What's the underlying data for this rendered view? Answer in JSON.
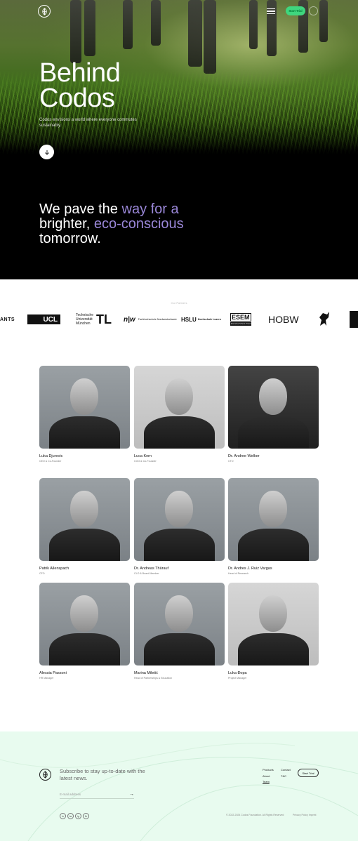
{
  "header": {
    "start_label": "Start Trial",
    "icons": [
      "codos-logo-icon",
      "menu-icon",
      "language-icon"
    ]
  },
  "hero": {
    "title_line1": "Behind",
    "title_line2": "Codos",
    "subtitle": "Codos envisions a world where everyone commutes sustainably."
  },
  "tagline": {
    "part1": "We pave the",
    "accent1": "way for a",
    "part2": "brighter,",
    "accent2": "eco-conscious",
    "part3": "tomorrow."
  },
  "partners": {
    "label": "Our Partners",
    "logos": [
      {
        "name": "ANTS"
      },
      {
        "name": "UCL"
      },
      {
        "line1": "Technische",
        "line2": "Universität",
        "line3": "München",
        "mark": "TL"
      },
      {
        "name": "n|w",
        "sub": "Fachhochschule Nordwestschweiz"
      },
      {
        "name": "HSLU",
        "sub": "Hochschule Luzern"
      },
      {
        "name": "ESEM",
        "sub": "Executive School of Economics and Management"
      },
      {
        "name": "HOBW"
      }
    ]
  },
  "team": [
    {
      "name": "Luka Djurovic",
      "role": "CEO & Co-Founder"
    },
    {
      "name": "Luca Kern",
      "role": "COO & Co-Founder"
    },
    {
      "name": "Dr. Andree Welker",
      "role": "CTO"
    },
    {
      "name": "Patrik Allenspach",
      "role": "CFO"
    },
    {
      "name": "Dr. Andreas Thürauf",
      "role": "CLO & Board Member"
    },
    {
      "name": "Dr. Andres J. Ruiz Vargas",
      "role": "Head of Research"
    },
    {
      "name": "Alessia Passoni",
      "role": "HR Manager"
    },
    {
      "name": "Marina Miletić",
      "role": "Head of Partnerships & Education"
    },
    {
      "name": "Luka Đopa",
      "role": "Project Manager"
    }
  ],
  "footer": {
    "subscribe": "Subscribe to stay up-to-date with the latest news.",
    "email_placeholder": "E-mail address",
    "nav": {
      "products": "Products",
      "contact": "Contact",
      "about": "About",
      "tc": "T&C",
      "team": "Team"
    },
    "start_label": "Start Trial",
    "social": [
      "in",
      "tw",
      "ig",
      "fb"
    ],
    "copyright": "© 2022-2024 Codos Foundation. All Rights Reserved",
    "legal": "Privacy Policy  Imprint"
  },
  "colors": {
    "accent": "#9a87d8",
    "brand_green": "#3fd67e",
    "footer_bg": "#e8fbef"
  }
}
